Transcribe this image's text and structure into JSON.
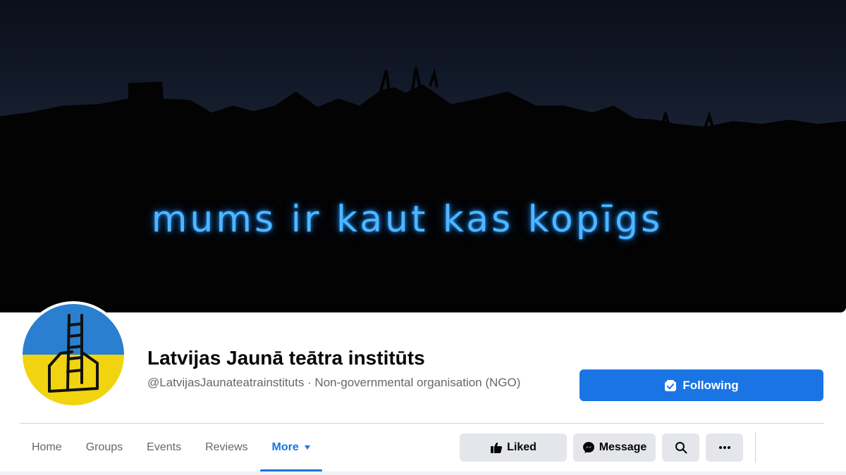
{
  "cover": {
    "text": "mums ir kaut kas kopīgs"
  },
  "page": {
    "name": "Latvijas Jaunā teātra institūts",
    "subtitle": "@LatvijasJaunateatrainstituts · Non-governmental organisation (NGO)"
  },
  "actions": {
    "following_label": "Following",
    "liked_label": "Liked",
    "message_label": "Message",
    "more_icon": "ellipsis-icon",
    "search_icon": "search-icon"
  },
  "tabs": [
    {
      "label": "Home"
    },
    {
      "label": "Groups"
    },
    {
      "label": "Events"
    },
    {
      "label": "Reviews"
    },
    {
      "label": "More"
    }
  ],
  "colors": {
    "accent": "#1b74e4",
    "secondary_button": "#e4e6eb",
    "cover_text": "#4fb6ff"
  }
}
